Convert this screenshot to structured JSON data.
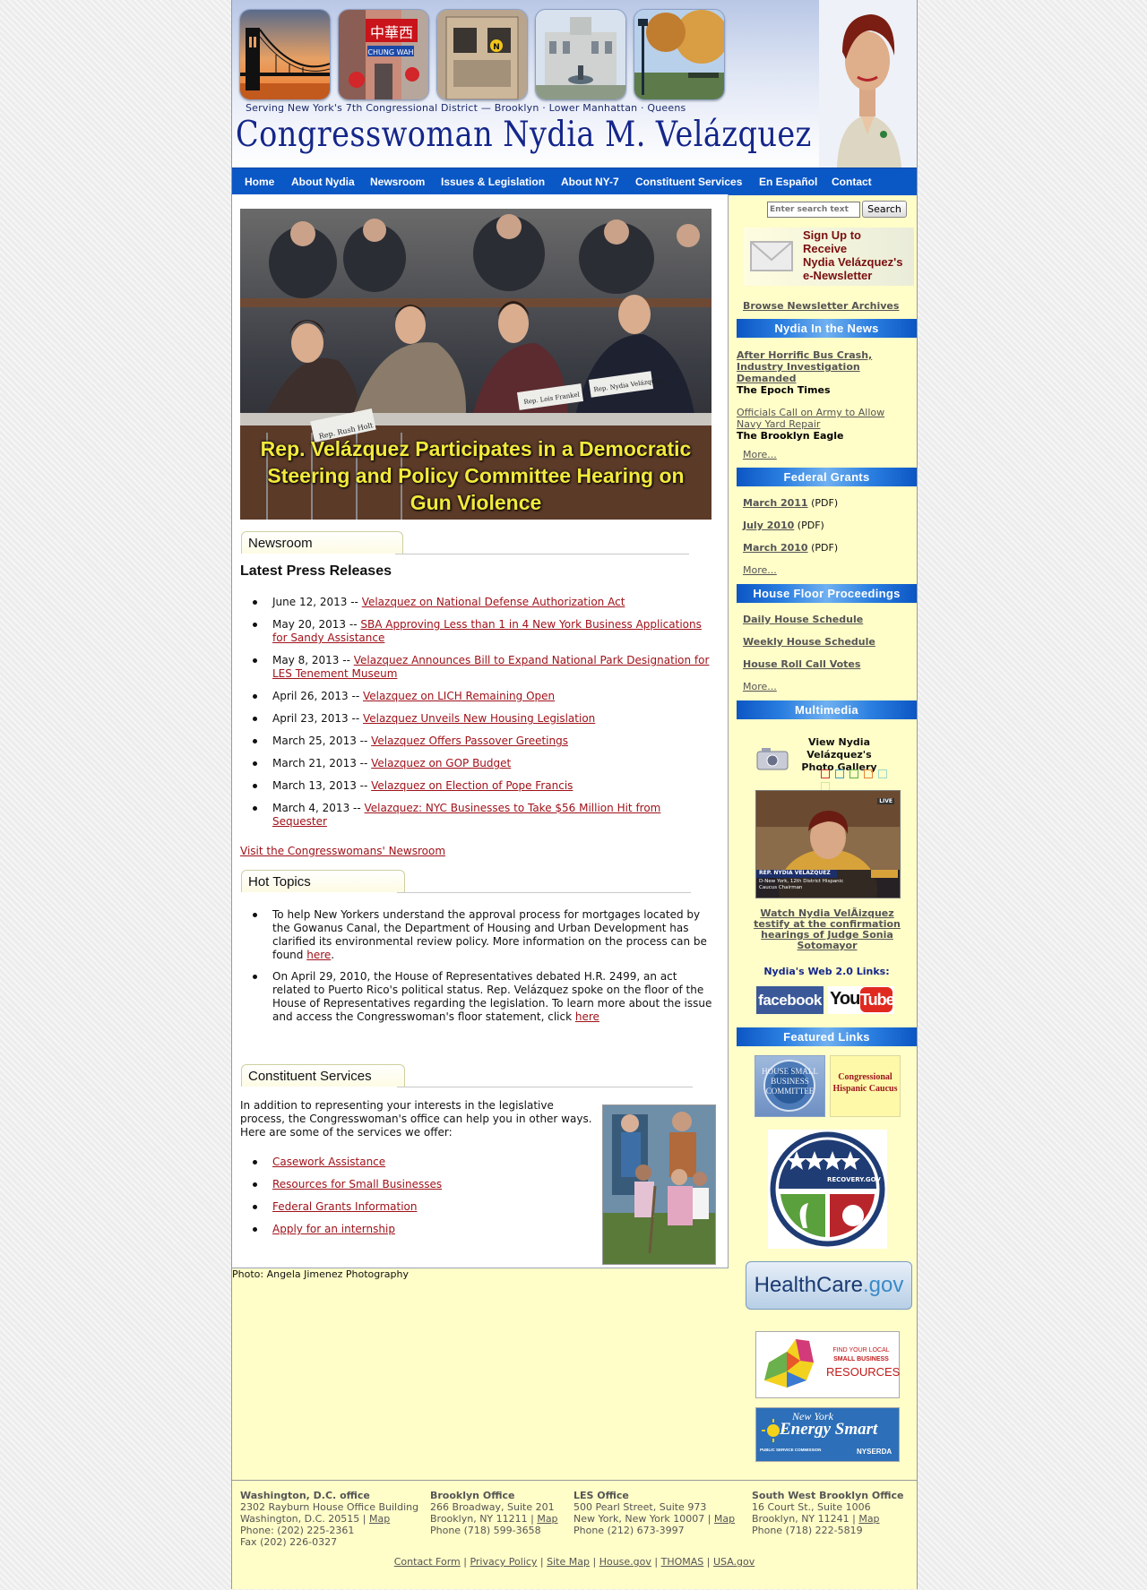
{
  "header": {
    "photos": [
      {
        "name": "brooklyn-bridge"
      },
      {
        "name": "chinatown-street",
        "sign_text": "中華西",
        "sign_sub": "CHUNG WAH"
      },
      {
        "name": "subway-car",
        "line_badge": "N"
      },
      {
        "name": "borough-hall"
      },
      {
        "name": "park-lamp"
      }
    ],
    "tagline": "Serving New York's 7th Congressional District — Brooklyn · Lower Manhattan · Queens",
    "title": "Congresswoman Nydia M. Velázquez"
  },
  "nav": {
    "items": [
      "Home",
      "About Nydia",
      "Newsroom",
      "Issues & Legislation",
      "About NY-7",
      "Constituent Services",
      "En Español",
      "Contact"
    ]
  },
  "hero": {
    "caption": "Rep. Velázquez Participates in a Democratic Steering and Policy Committee Hearing on Gun Violence",
    "nameplates": [
      "Rep. Rush Holt",
      "Rep. Lois Frankel",
      "Rep. Nydia Velázquez"
    ]
  },
  "newsroom": {
    "tab": "Newsroom",
    "heading": "Latest Press Releases",
    "items": [
      {
        "date": "June 12, 2013",
        "sep": " -- ",
        "link": "Velazquez on National Defense Authorization Act"
      },
      {
        "date": "May 20, 2013",
        "sep": " -- ",
        "link": "SBA Approving Less than 1 in 4 New York Business Applications for Sandy Assistance"
      },
      {
        "date": "May 8, 2013",
        "sep": " -- ",
        "link": "Velazquez Announces Bill to Expand National Park Designation for LES Tenement Museum"
      },
      {
        "date": "April 26, 2013",
        "sep": " -- ",
        "link": "Velazquez on LICH Remaining Open"
      },
      {
        "date": "April 23, 2013",
        "sep": " -- ",
        "link": "Velazquez Unveils New Housing Legislation"
      },
      {
        "date": "March 25, 2013",
        "sep": " -- ",
        "link": "Velazquez Offers Passover Greetings"
      },
      {
        "date": "March 21, 2013",
        "sep": " -- ",
        "link": "Velazquez on GOP Budget"
      },
      {
        "date": "March 13, 2013",
        "sep": " -- ",
        "link": "Velazquez on Election of Pope Francis"
      },
      {
        "date": "March 4, 2013",
        "sep": " -- ",
        "link": "Velazquez: NYC Businesses to Take $56 Million Hit from Sequester"
      }
    ],
    "visit_link": "Visit the Congresswomans' Newsroom"
  },
  "hot_topics": {
    "tab": "Hot Topics",
    "items": [
      {
        "text": "To help New Yorkers understand the approval process for mortgages located by the Gowanus Canal, the Department of Housing and Urban Development has clarified its environmental review policy. More information on the process can be found ",
        "link": "here",
        "tail": "."
      },
      {
        "text": "On April 29, 2010, the House of Representatives debated H.R. 2499, an act related to Puerto Rico's political status. Rep. Velázquez spoke on the floor of the House of Representatives regarding the legislation. To learn more about the issue and access the Congresswoman's floor statement, click ",
        "link": "here",
        "tail": ""
      }
    ]
  },
  "constituent": {
    "tab": "Constituent Services",
    "intro": "In addition to representing your interests in the legislative process, the Congresswoman's office can help you in other ways. Here are some of the services we offer:",
    "services": [
      "Casework Assistance",
      "Resources for Small Businesses",
      "Federal Grants Information",
      "Apply for an internship"
    ],
    "photo_credit": "Photo: Angela Jimenez Photography"
  },
  "sidebar": {
    "search": {
      "placeholder": "Enter search text",
      "button": "Search"
    },
    "newsletter": {
      "line1": "Sign Up to",
      "line2": "Receive",
      "line3": "Nydia Velázquez's",
      "line4": "e-Newsletter",
      "archives": "Browse Newsletter Archives"
    },
    "in_news": {
      "heading": "Nydia In the News",
      "items": [
        {
          "title": "After Horrific Bus Crash, Industry Investigation Demanded",
          "source": "The Epoch Times"
        },
        {
          "title": "Officials Call on Army to Allow Navy Yard Repair",
          "source": "The Brooklyn Eagle"
        }
      ],
      "more": "More..."
    },
    "grants": {
      "heading": "Federal Grants",
      "items": [
        {
          "link": "March 2011",
          "suffix": " (PDF)"
        },
        {
          "link": "July 2010",
          "suffix": " (PDF)"
        },
        {
          "link": "March 2010",
          "suffix": " (PDF)"
        }
      ],
      "more": "More..."
    },
    "floor": {
      "heading": "House Floor Proceedings",
      "items": [
        "Daily House Schedule",
        "Weekly House Schedule",
        "House Roll Call Votes"
      ],
      "more": "More..."
    },
    "multimedia": {
      "heading": "Multimedia",
      "gallery_line1": "View Nydia Velázquez's",
      "gallery_line2": "Photo Gallery",
      "video_nameplate": "REP. NYDIA VELAZQUEZ",
      "video_sub": "D-New York, 12th District Hispanic Caucus Chairman",
      "video_live": "LIVE",
      "video_link": "Watch Nydia VelÃizquez testify at the confirmation hearings of Judge Sonia Sotomayor",
      "web20": "Nydia's Web 2.0 Links:",
      "facebook": "facebook",
      "youtube_a": "You",
      "youtube_b": "Tube"
    },
    "featured": {
      "heading": "Featured Links",
      "small_business": "HOUSE SMALL BUSINESS COMMITTEE",
      "hispanic_caucus": "Congressional Hispanic Caucus",
      "recovery": "RECOVERY.GOV",
      "healthcare_a": "Health",
      "healthcare_b": "Care",
      "healthcare_c": ".gov",
      "sb_resources_1": "FIND YOUR LOCAL",
      "sb_resources_2": "SMALL BUSINESS",
      "sb_resources_3": "RESOURCES",
      "energy_1": "New York",
      "energy_2": "Energy Smart",
      "energy_3": "PUBLIC SERVICE COMMISSION",
      "energy_4": "NYSERDA"
    }
  },
  "footer": {
    "offices": [
      {
        "name": "Washington, D.C. office",
        "lines": [
          "2302 Rayburn House Office Building"
        ],
        "city": "Washington, D.C. 20515 | ",
        "map": "Map",
        "phone": "Phone: (202) 225-2361",
        "fax": "Fax (202) 226-0327"
      },
      {
        "name": "Brooklyn Office",
        "lines": [
          "266 Broadway, Suite 201"
        ],
        "city": "Brooklyn, NY 11211 | ",
        "map": "Map",
        "phone": "Phone (718) 599-3658",
        "fax": ""
      },
      {
        "name": "LES Office",
        "lines": [
          "500 Pearl Street, Suite 973"
        ],
        "city": "New York, New York 10007 | ",
        "map": "Map",
        "phone": "Phone (212) 673-3997",
        "fax": ""
      },
      {
        "name": "South West Brooklyn Office",
        "lines": [
          "16 Court St., Suite 1006"
        ],
        "city": "Brooklyn, NY 11241 | ",
        "map": "Map",
        "phone": "Phone (718) 222-5819",
        "fax": ""
      }
    ],
    "links": [
      "Contact Form",
      "Privacy Policy",
      "Site Map",
      "House.gov",
      "THOMAS",
      "USA.gov"
    ],
    "separator": " | "
  }
}
